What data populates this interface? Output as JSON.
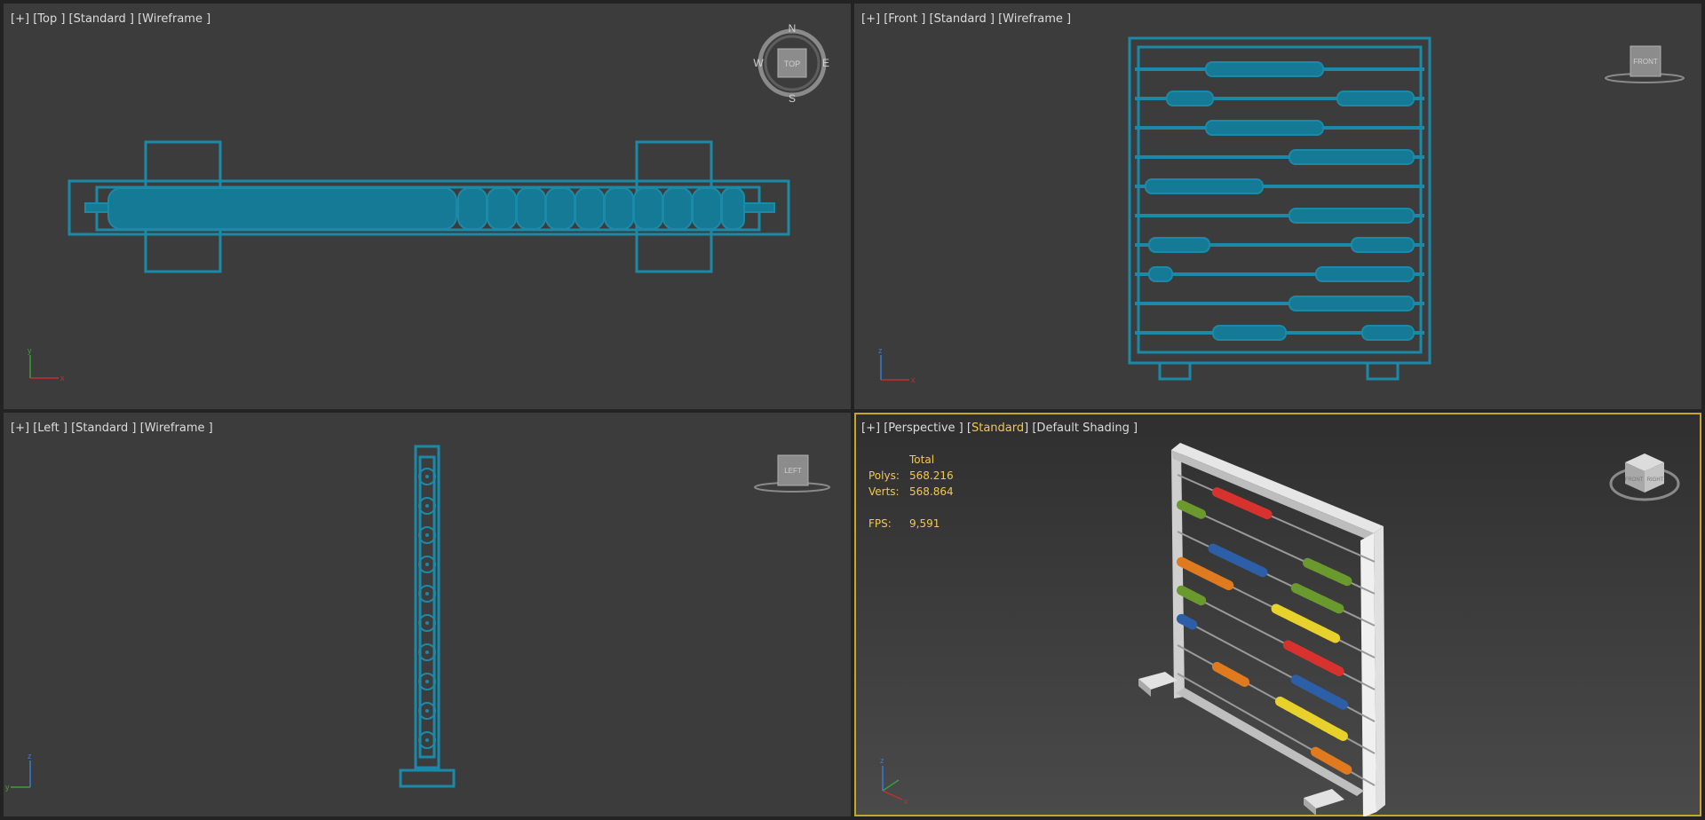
{
  "viewports": {
    "top": {
      "btn": "[+]",
      "view": "[Top ]",
      "mode": "[Standard ]",
      "shading": "[Wireframe ]"
    },
    "front": {
      "btn": "[+]",
      "view": "[Front ]",
      "mode": "[Standard ]",
      "shading": "[Wireframe ]"
    },
    "left": {
      "btn": "[+]",
      "view": "[Left ]",
      "mode": "[Standard ]",
      "shading": "[Wireframe ]"
    },
    "persp": {
      "btn": "[+]",
      "view": "[Perspective ]",
      "mode_open": "[",
      "mode": "Standard",
      "mode_close": "]",
      "shading": "[Default Shading ]"
    }
  },
  "stats": {
    "header": "Total",
    "polys_label": "Polys:",
    "polys_value": "568.216",
    "verts_label": "Verts:",
    "verts_value": "568.864",
    "fps_label": "FPS:",
    "fps_value": "9,591"
  },
  "compass": {
    "n": "N",
    "s": "S",
    "e": "E",
    "w": "W",
    "top_face": "TOP"
  },
  "viewcube": {
    "front": "FRONT",
    "left": "LEFT",
    "persp_front": "FRONT",
    "persp_right": "RIGHT"
  },
  "axes": {
    "x": "x",
    "y": "y",
    "z": "z"
  },
  "colors": {
    "wire": "#1b8aa8",
    "accent": "#f2c94c",
    "red": "#d8322e",
    "blue": "#2d5fa8",
    "green": "#6a9a2e",
    "orange": "#e07a1e",
    "yellow": "#e8d12a"
  }
}
